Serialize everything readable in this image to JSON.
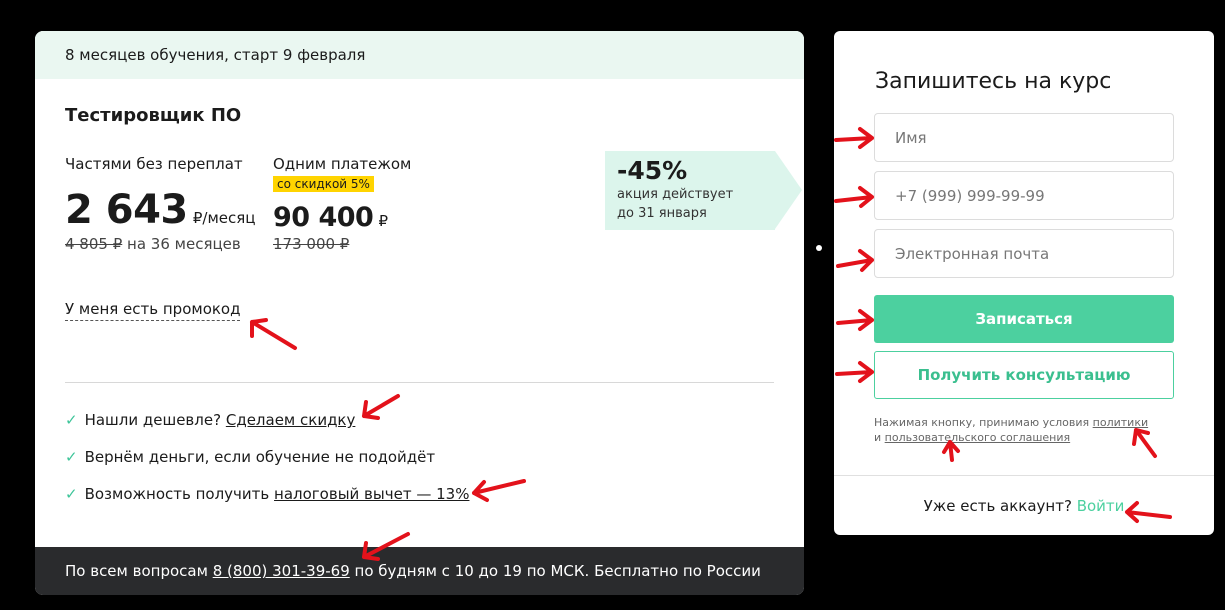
{
  "course": {
    "banner": "8 месяцев обучения, старт 9 февраля",
    "title": "Тестировщик ПО",
    "installment": {
      "label": "Частями без переплат",
      "price": "2 643",
      "unit": "₽/месяц",
      "old_price": "4 805 ₽",
      "term": " на 36 месяцев"
    },
    "full": {
      "label": "Одним платежом",
      "badge": "со скидкой 5%",
      "price": "90 400",
      "unit": "₽",
      "old_price": "173 000 ₽"
    },
    "promo": {
      "percent": "-45%",
      "line1": "акция действует",
      "line2": "до 31 января"
    },
    "promo_link": "У меня есть промокод",
    "benefits": [
      {
        "text": "Нашли дешевле? ",
        "link": "Сделаем скидку"
      },
      {
        "text": "Вернём деньги, если обучение не подойдёт",
        "link": ""
      },
      {
        "text": "Возможность получить ",
        "link": "налоговый вычет — 13%"
      }
    ],
    "footer": {
      "prefix": "По всем вопросам ",
      "phone": "8 (800) 301-39-69",
      "suffix": " по будням с 10 до 19 по МСК. Бесплатно по России"
    }
  },
  "form": {
    "title": "Запишитесь на курс",
    "name_placeholder": "Имя",
    "phone_placeholder": "+7 (999) 999-99-99",
    "email_placeholder": "Электронная почта",
    "submit_label": "Записаться",
    "consult_label": "Получить консультацию",
    "terms_prefix": "Нажимая кнопку, принимаю условия ",
    "terms_policy": "политики",
    "terms_and": "и ",
    "terms_agreement": "пользовательского соглашения",
    "login_prompt": "Уже есть аккаунт? ",
    "login_link": "Войти"
  },
  "colors": {
    "accent": "#4cd09f",
    "banner_bg": "#eaf7f1",
    "badge": "#ffd400",
    "footer_bg": "#2a2b2d",
    "annotation": "#e3121b"
  }
}
